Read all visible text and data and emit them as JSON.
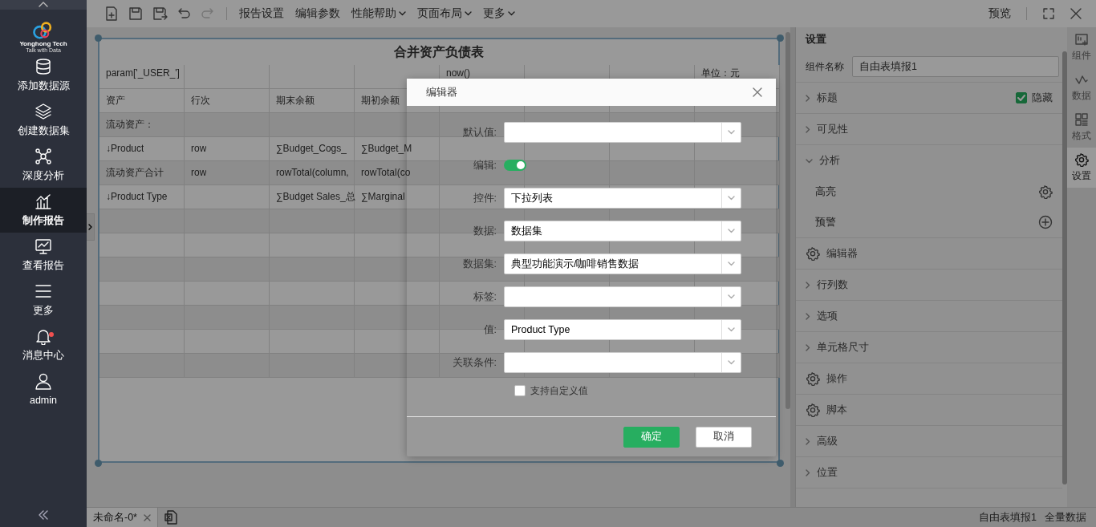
{
  "sidebar": {
    "logo": {
      "name": "Yonghong Tech",
      "tagline": "Talk with Data"
    },
    "items": [
      {
        "label": "添加数据源",
        "selected": false,
        "badge": false
      },
      {
        "label": "创建数据集",
        "selected": false,
        "badge": false
      },
      {
        "label": "深度分析",
        "selected": false,
        "badge": false
      },
      {
        "label": "制作报告",
        "selected": true,
        "badge": false
      },
      {
        "label": "查看报告",
        "selected": false,
        "badge": false
      },
      {
        "label": "更多",
        "selected": false,
        "badge": false
      },
      {
        "label": "消息中心",
        "selected": false,
        "badge": true
      },
      {
        "label": "admin",
        "selected": false,
        "badge": false
      }
    ]
  },
  "toolbar": {
    "icon_buttons": [
      {
        "disabled": false
      },
      {
        "disabled": false
      },
      {
        "disabled": false
      },
      {
        "disabled": false
      },
      {
        "disabled": true
      }
    ],
    "menus": [
      {
        "label": "报告设置",
        "dropdown": false
      },
      {
        "label": "编辑参数",
        "dropdown": false
      },
      {
        "label": "性能帮助",
        "dropdown": true
      },
      {
        "label": "页面布局",
        "dropdown": true
      },
      {
        "label": "更多",
        "dropdown": true
      }
    ],
    "preview": "预览"
  },
  "report": {
    "title": "合并资产负债表",
    "rows": [
      [
        "param['_USER_']",
        null,
        null,
        null,
        "now()",
        null,
        null,
        "单位：元"
      ],
      [
        "资产",
        "行次",
        "期末余额",
        "期初余额",
        null,
        null,
        null,
        null
      ],
      [
        "流动资产：",
        null,
        null,
        null,
        null,
        null,
        null,
        null
      ],
      [
        "↓Product",
        "row",
        "∑Budget_Cogs_",
        "∑Budget_M",
        null,
        null,
        null,
        null
      ],
      [
        "流动资产合计",
        "row",
        "rowTotal(column,",
        "rowTotal(co",
        null,
        null,
        null,
        null
      ],
      [
        "↓Product Type",
        null,
        "∑Budget Sales_总",
        "∑Marginal",
        null,
        null,
        null,
        null
      ]
    ]
  },
  "dialog": {
    "title": "编辑器",
    "fields": [
      {
        "label": "默认值:",
        "kind": "select"
      },
      {
        "label": "编辑:",
        "kind": "toggle",
        "on": true
      },
      {
        "label": "控件:",
        "kind": "select",
        "value": "下拉列表"
      },
      {
        "label": "数据:",
        "kind": "select",
        "value": "数据集"
      },
      {
        "label": "数据集:",
        "kind": "select",
        "value": "典型功能演示/咖啡销售数据"
      },
      {
        "label": "标签:",
        "kind": "select"
      },
      {
        "label": "值:",
        "kind": "select",
        "value": "Product Type"
      },
      {
        "label": "关联条件:",
        "kind": "select"
      }
    ],
    "checkbox": {
      "label": "支持自定义值",
      "checked": false
    },
    "buttons": [
      {
        "label": "确定",
        "kind": "primary"
      },
      {
        "label": "取消",
        "kind": "secondary"
      }
    ]
  },
  "settings": {
    "title": "设置",
    "name_label": "组件名称",
    "name_value": "自由表填报1",
    "sections": [
      {
        "label": "标题",
        "kind": "group",
        "expanded": false,
        "checkbox": {
          "label": "隐藏",
          "checked": true
        }
      },
      {
        "label": "可见性",
        "kind": "group",
        "expanded": false
      },
      {
        "label": "分析",
        "kind": "group",
        "expanded": true,
        "children": [
          {
            "label": "高亮",
            "kind": "gear"
          },
          {
            "label": "预警",
            "kind": "add"
          }
        ]
      },
      {
        "label": "编辑器",
        "kind": "action"
      },
      {
        "label": "行列数",
        "kind": "group",
        "expanded": false
      },
      {
        "label": "选项",
        "kind": "group",
        "expanded": false
      },
      {
        "label": "单元格尺寸",
        "kind": "group",
        "expanded": false
      },
      {
        "label": "操作",
        "kind": "action"
      },
      {
        "label": "脚本",
        "kind": "action"
      },
      {
        "label": "高级",
        "kind": "group",
        "expanded": false
      },
      {
        "label": "位置",
        "kind": "group",
        "expanded": false
      }
    ]
  },
  "side_tabs": [
    {
      "label": "组件",
      "selected": false
    },
    {
      "label": "数据",
      "selected": false
    },
    {
      "label": "格式",
      "selected": false
    },
    {
      "label": "设置",
      "selected": true
    }
  ],
  "status_bar": {
    "tabs": [
      {
        "label": "未命名-0*",
        "selected": true
      }
    ],
    "component": "自由表填报1",
    "mode": "全量数据"
  }
}
